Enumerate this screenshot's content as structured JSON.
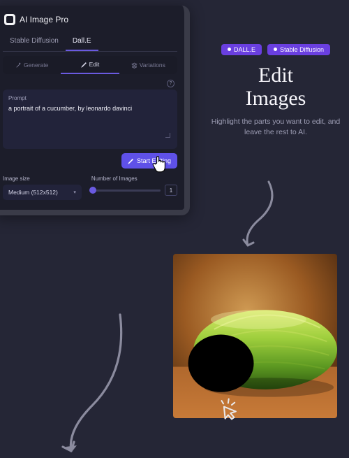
{
  "app": {
    "title": "AI Image Pro"
  },
  "modelTabs": [
    {
      "label": "Stable Diffusion",
      "active": false
    },
    {
      "label": "Dall.E",
      "active": true
    }
  ],
  "modeTabs": [
    {
      "label": "Generate",
      "icon": "wand-icon",
      "active": false
    },
    {
      "label": "Edit",
      "icon": "pencil-icon",
      "active": true
    },
    {
      "label": "Variations",
      "icon": "layers-icon",
      "active": false
    }
  ],
  "prompt": {
    "label": "Prompt",
    "value": "a portrait of a cucumber, by leonardo davinci"
  },
  "startButton": "Start Editing",
  "imageSize": {
    "label": "Image size",
    "value": "Medium (512x512)"
  },
  "numImages": {
    "label": "Number of Images",
    "value": "1"
  },
  "hero": {
    "pills": [
      "DALL.E",
      "Stable Diffusion"
    ],
    "title_l1": "Edit",
    "title_l2": "Images",
    "subtitle": "Highlight the parts you want to edit, and leave the rest to AI."
  },
  "colors": {
    "accent": "#6a5ae0",
    "pill": "#6a3fe0",
    "bg": "#252636",
    "panel": "#1c1d2a"
  }
}
